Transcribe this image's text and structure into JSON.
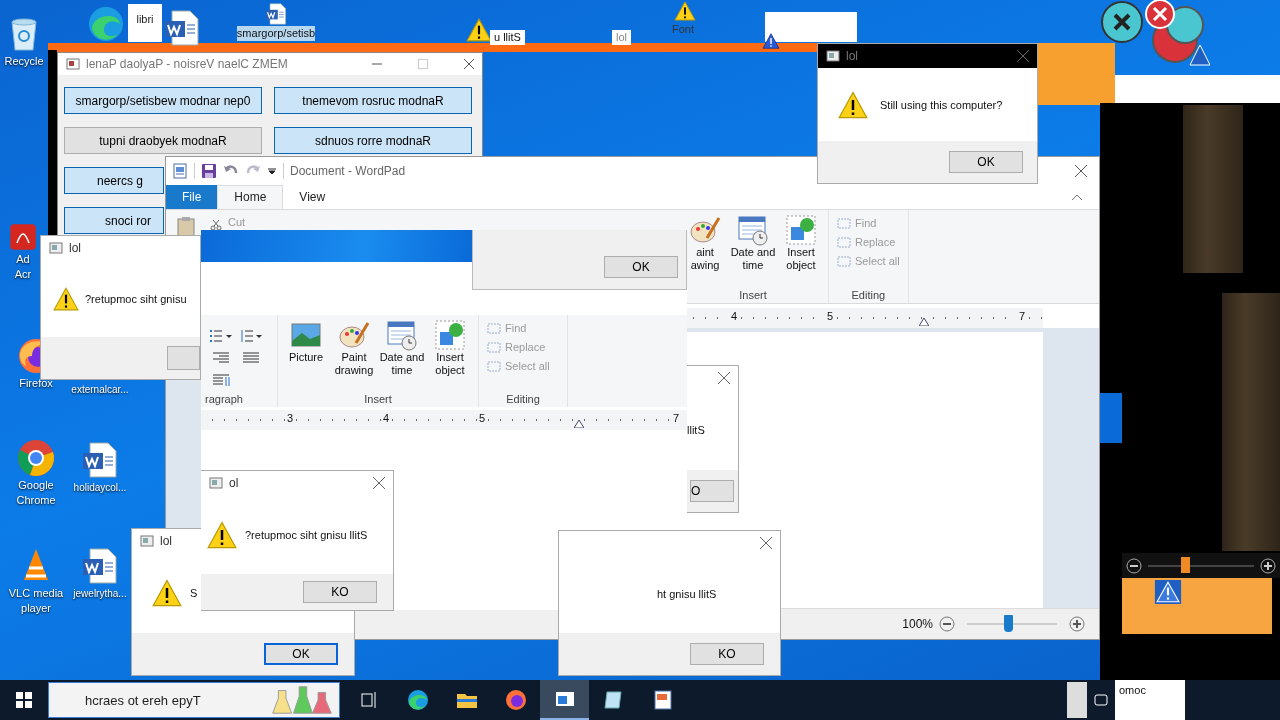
{
  "desktop_icons": [
    {
      "label": "Recycle",
      "kind": "recycle"
    },
    {
      "kind": "edge"
    },
    {
      "label": "libri",
      "kind": "tile"
    },
    {
      "kind": "word"
    },
    {
      "label": "smargorp/setisb",
      "kind": "word"
    },
    {
      "label": "Ad Acr",
      "kind": "acrobat"
    },
    {
      "label": "Firefox",
      "kind": "firefox"
    },
    {
      "label": "Google Chrome",
      "kind": "chrome"
    },
    {
      "label": "VLC media player",
      "kind": "vlc"
    },
    {
      "label": "externalcar...",
      "kind": "none"
    },
    {
      "label": "holidaycol...",
      "kind": "word"
    },
    {
      "label": "jewelrytha...",
      "kind": "word"
    }
  ],
  "top_fragments": [
    {
      "text": "u llitS"
    },
    {
      "text": "lol"
    },
    {
      "text": "Font"
    }
  ],
  "memz_window": {
    "title": "lenaP daolyaP - noisreV naelC ZMEM",
    "buttons": [
      {
        "label": "smargorp/setisbew modnar nep0",
        "highlighted": true
      },
      {
        "label": "tnemevom rosruc modnaR",
        "highlighted": true
      },
      {
        "label": "tupni draobyek modnaR",
        "highlighted": false
      },
      {
        "label": "sdnuos rorre modnaR",
        "highlighted": true
      },
      {
        "label": "neercs g",
        "highlighted": true
      },
      {
        "label": "snoci ror",
        "highlighted": true
      }
    ]
  },
  "wordpad": {
    "title": "Document - WordPad",
    "tabs": [
      {
        "label": "File",
        "selected": false,
        "kind": "file"
      },
      {
        "label": "Home",
        "selected": true,
        "kind": "tab"
      },
      {
        "label": "View",
        "selected": false,
        "kind": "tab"
      }
    ],
    "clipboard_items": [
      "Cut"
    ],
    "insert_items": [
      {
        "label": "aint\nawing",
        "kind": "paint"
      },
      {
        "label": "Date and\ntime",
        "kind": "date"
      },
      {
        "label": "Insert\nobject",
        "kind": "object"
      }
    ],
    "insert_group": "Insert",
    "editing_items": [
      {
        "label": "Find",
        "disabled": true
      },
      {
        "label": "Replace",
        "disabled": true
      },
      {
        "label": "Select all",
        "disabled": true
      }
    ],
    "editing_group": "Editing",
    "ruler": [
      "4",
      "5",
      "7"
    ],
    "zoom": {
      "reading": "100%",
      "level": 0.45
    }
  },
  "glitch_copy": {
    "button": "OK",
    "insert_items": [
      {
        "label": "Picture",
        "kind": "picture"
      },
      {
        "label": "Paint\ndrawing",
        "kind": "paint"
      },
      {
        "label": "Date and\ntime",
        "kind": "date"
      },
      {
        "label": "Insert\nobject",
        "kind": "object"
      }
    ],
    "groups": [
      "ragraph",
      "Insert",
      "Editing"
    ],
    "editing_items": [
      {
        "label": "Find",
        "disabled": true
      },
      {
        "label": "Replace",
        "disabled": true
      },
      {
        "label": "Select all",
        "disabled": true
      }
    ],
    "ruler": [
      "3",
      "4",
      "5",
      "7"
    ]
  },
  "dialogs": [
    {
      "title": "lol",
      "message": "Still using this computer?",
      "button": "OK",
      "kind": "full",
      "focused": false
    },
    {
      "title": "lol",
      "message": "?retupmoc siht gnisu",
      "kind": "full",
      "focused": false
    },
    {
      "title": "ol",
      "message": "?retupmoc siht gnisu llitS",
      "button": "KO",
      "kind": "full",
      "focused": false
    },
    {
      "title": "lol",
      "message": "S",
      "button": "OK",
      "kind": "full",
      "focused": true
    },
    {
      "message": "llitS",
      "button": "O",
      "kind": "clipped",
      "focused": false
    },
    {
      "message": "ht gnisu llitS",
      "button": "KO",
      "kind": "clipped",
      "focused": false
    }
  ],
  "mini_zoom": {
    "level": 0.35
  },
  "taskbar": {
    "search_placeholder": "hcraes ot ereh epyT",
    "apps": [
      {
        "kind": "taskview",
        "selected": false
      },
      {
        "kind": "edge",
        "selected": false
      },
      {
        "kind": "explorer",
        "selected": false
      },
      {
        "kind": "firefox",
        "selected": false
      },
      {
        "kind": "window",
        "selected": true
      },
      {
        "kind": "notepad",
        "selected": false
      },
      {
        "kind": "wordpad",
        "selected": false
      }
    ],
    "tray_text": "omoc"
  }
}
